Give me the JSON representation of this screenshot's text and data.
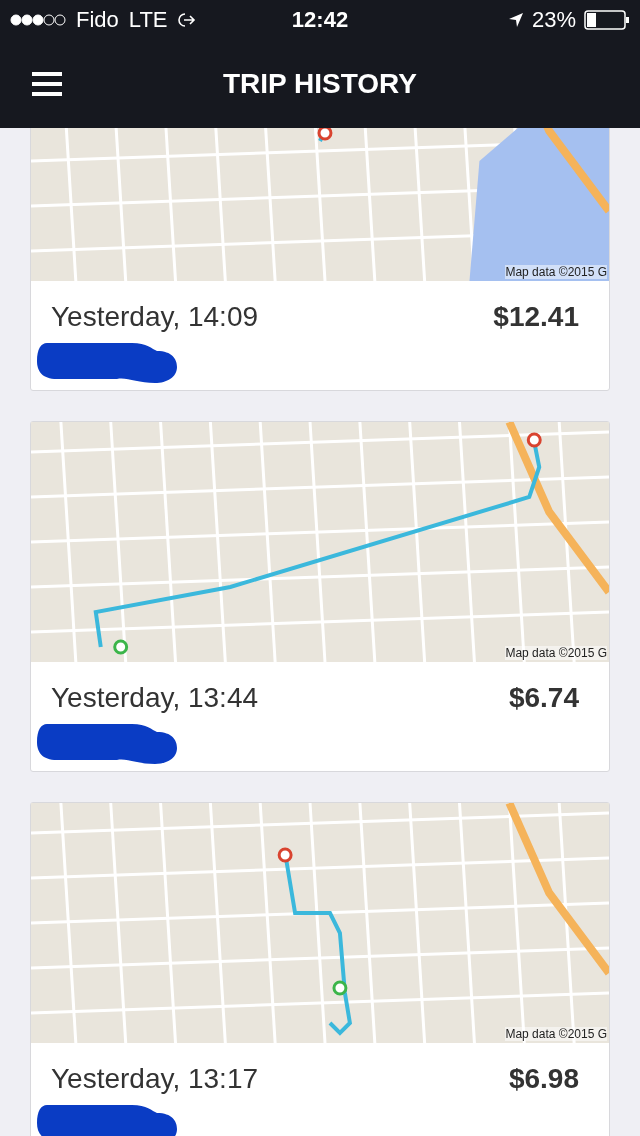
{
  "status_bar": {
    "carrier": "Fido",
    "network": "LTE",
    "time": "12:42",
    "battery": "23%"
  },
  "header": {
    "title": "TRIP HISTORY"
  },
  "trips": [
    {
      "date": "Yesterday, 14:09",
      "price": "$12.41",
      "map_attribution": "Map data ©2015 G"
    },
    {
      "date": "Yesterday, 13:44",
      "price": "$6.74",
      "map_attribution": "Map data ©2015 G"
    },
    {
      "date": "Yesterday, 13:17",
      "price": "$6.98",
      "map_attribution": "Map data ©2015 G"
    }
  ]
}
